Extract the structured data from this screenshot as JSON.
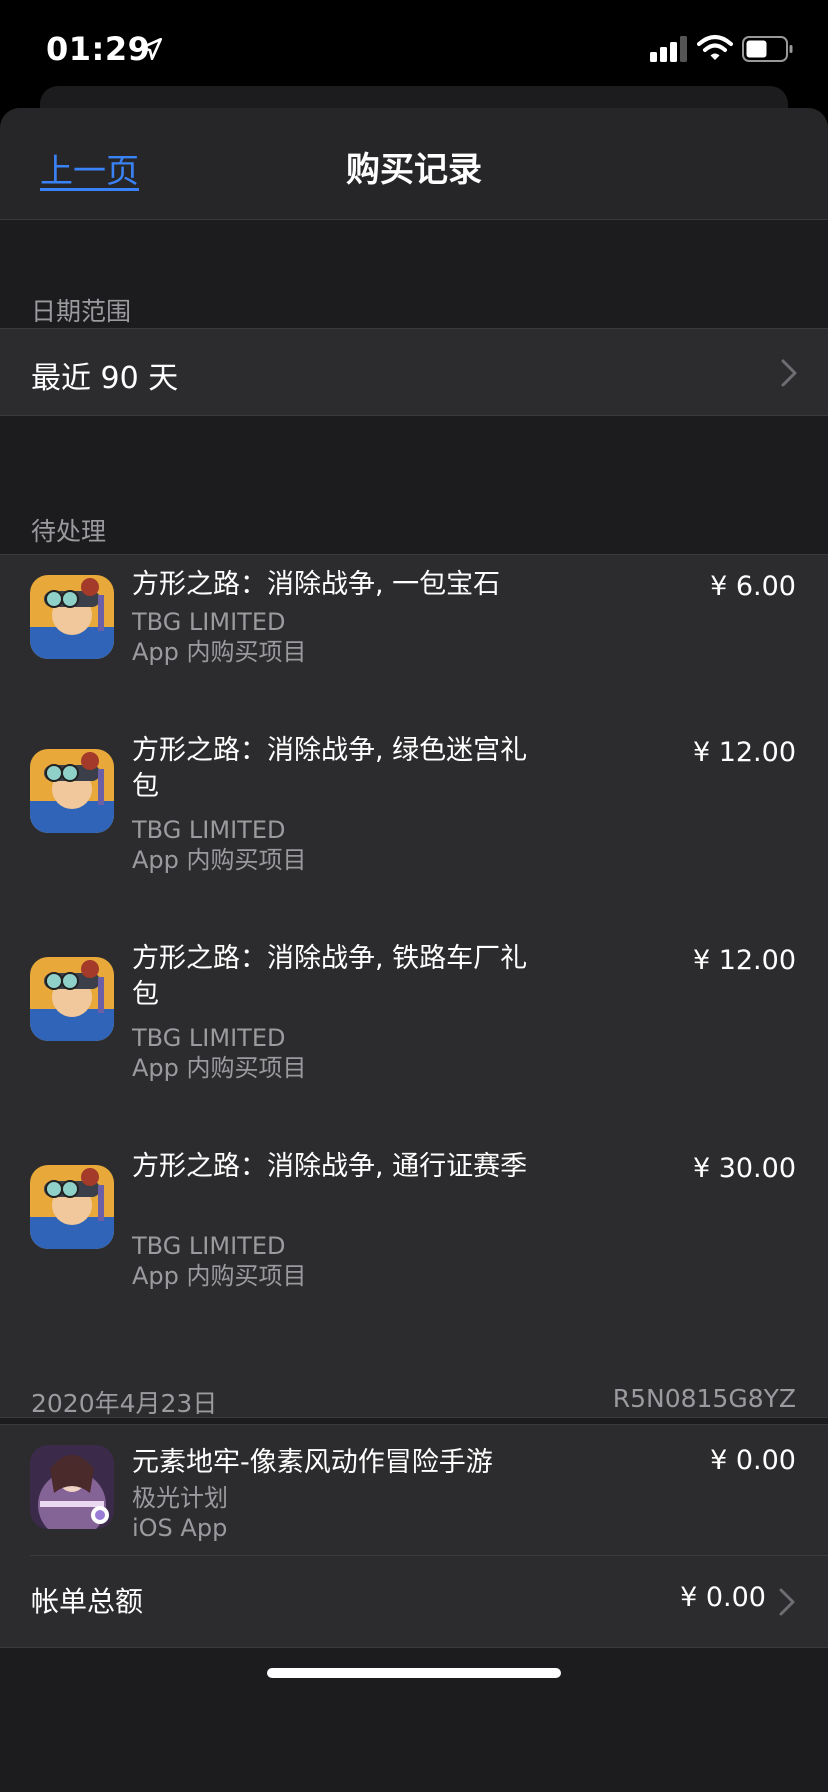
{
  "status": {
    "time": "01:29"
  },
  "nav": {
    "back_label": "上一页",
    "title": "购买记录"
  },
  "date_range": {
    "section_label": "日期范围",
    "value": "最近 90 天"
  },
  "pending": {
    "section_label": "待处理",
    "items": [
      {
        "title": "方形之路：消除战争, 一包宝石",
        "developer": "TBG LIMITED",
        "type": "App 内购买项目",
        "price": "¥ 6.00"
      },
      {
        "title": "方形之路：消除战争, 绿色迷宫礼包",
        "developer": "TBG LIMITED",
        "type": "App 内购买项目",
        "price": "¥ 12.00"
      },
      {
        "title": "方形之路：消除战争, 铁路车厂礼包",
        "developer": "TBG LIMITED",
        "type": "App 内购买项目",
        "price": "¥ 12.00"
      },
      {
        "title": "方形之路：消除战争, 通行证赛季",
        "developer": "TBG LIMITED",
        "type": "App 内购买项目",
        "price": "¥ 30.00"
      }
    ]
  },
  "receipt": {
    "date": "2020年4月23日",
    "order_id": "R5N0815G8YZ",
    "item": {
      "title": "元素地牢-像素风动作冒险手游",
      "developer": "极光计划",
      "type": "iOS App",
      "price": "¥ 0.00"
    },
    "total_label": "帐单总额",
    "total_value": "¥ 0.00"
  },
  "colors": {
    "link": "#3a82f7",
    "background": "#1c1c1e",
    "cell": "#2c2c2e"
  }
}
